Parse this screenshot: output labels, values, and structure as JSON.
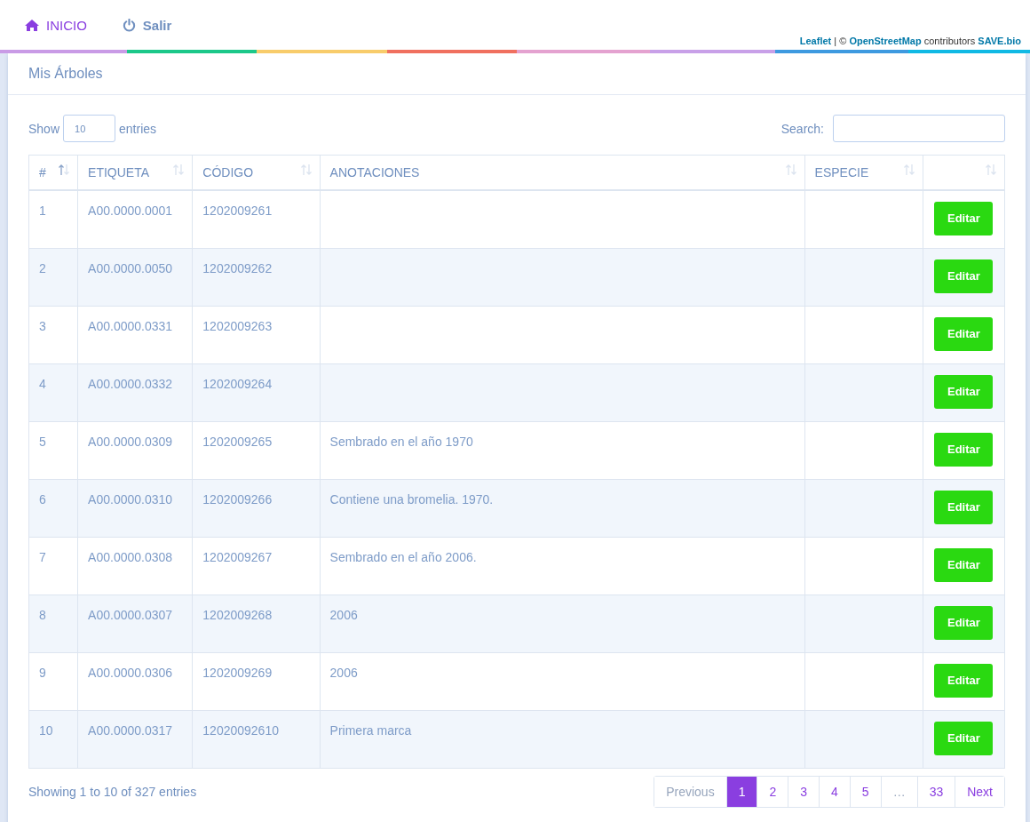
{
  "nav": {
    "items": [
      {
        "label": "INICIO",
        "selected": true
      },
      {
        "label": "Salir",
        "selected": false
      }
    ]
  },
  "attribution": {
    "links": [
      "Leaflet",
      "OpenStreetMap",
      "SAVE.bio"
    ],
    "separator": "|",
    "copyright": "©",
    "contributors": "contributors"
  },
  "card": {
    "title": "Mis Árboles"
  },
  "length_control": {
    "before": "Show",
    "value": "10",
    "after": "entries"
  },
  "search": {
    "label": "Search:"
  },
  "table": {
    "columns": [
      {
        "label": "#",
        "sorted": true
      },
      {
        "label": "ETIQUETA",
        "sorted": false
      },
      {
        "label": "CÓDIGO",
        "sorted": false
      },
      {
        "label": "ANOTACIONES",
        "sorted": false
      },
      {
        "label": "ESPECIE",
        "sorted": false
      },
      {
        "sorted": false
      }
    ],
    "rows": [
      [
        "1",
        "A00.0000.0001",
        "1202009261",
        "",
        "",
        "Editar"
      ],
      [
        "2",
        "A00.0000.0050",
        "1202009262",
        "",
        "",
        "Editar"
      ],
      [
        "3",
        "A00.0000.0331",
        "1202009263",
        "",
        "",
        "Editar"
      ],
      [
        "4",
        "A00.0000.0332",
        "1202009264",
        "",
        "",
        "Editar"
      ],
      [
        "5",
        "A00.0000.0309",
        "1202009265",
        "Sembrado en el año 1970",
        "",
        "Editar"
      ],
      [
        "6",
        "A00.0000.0310",
        "1202009266",
        "Contiene una bromelia. 1970.",
        "",
        "Editar"
      ],
      [
        "7",
        "A00.0000.0308",
        "1202009267",
        "Sembrado en el año 2006.",
        "",
        "Editar"
      ],
      [
        "8",
        "A00.0000.0307",
        "1202009268",
        "2006",
        "",
        "Editar"
      ],
      [
        "9",
        "A00.0000.0306",
        "1202009269",
        "2006",
        "",
        "Editar"
      ],
      [
        "10",
        "A00.0000.0317",
        "12020092610",
        "Primera marca",
        "",
        "Editar"
      ]
    ]
  },
  "info": "Showing 1 to 10 of 327 entries",
  "pagination": [
    {
      "kind": "prev",
      "label": "Previous",
      "disabled": true,
      "selected": false
    },
    {
      "kind": "page",
      "label": "1",
      "selected": true
    },
    {
      "kind": "page",
      "label": "2",
      "selected": false
    },
    {
      "kind": "page",
      "label": "3",
      "selected": false
    },
    {
      "kind": "page",
      "label": "4",
      "selected": false
    },
    {
      "kind": "page",
      "label": "5",
      "selected": false
    },
    {
      "kind": "ellipsis",
      "label": "…",
      "selected": false
    },
    {
      "kind": "page",
      "label": "33",
      "selected": false
    },
    {
      "kind": "next",
      "label": "Next",
      "disabled": false,
      "selected": false
    }
  ]
}
